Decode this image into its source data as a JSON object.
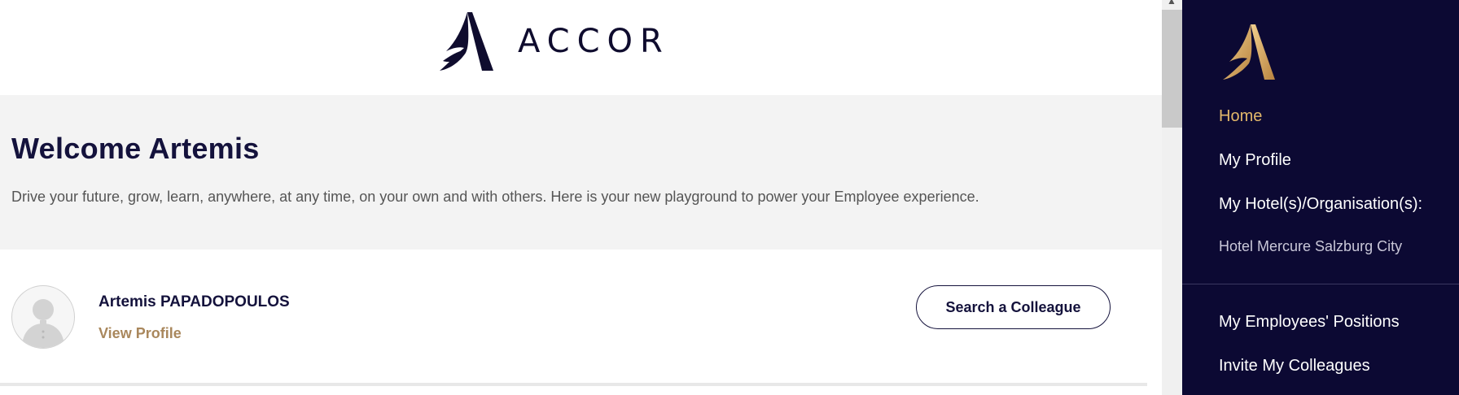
{
  "header": {
    "brand": "ACCOR"
  },
  "hero": {
    "title": "Welcome Artemis",
    "subtitle": "Drive your future, grow, learn, anywhere, at any time, on your own and with others. Here is your new playground to power your Employee experience."
  },
  "profile_card": {
    "name": "Artemis PAPADOPOULOS",
    "view_profile": "View Profile",
    "search_button": "Search a Colleague"
  },
  "sidebar": {
    "items": [
      {
        "label": "Home",
        "active": true
      },
      {
        "label": "My Profile"
      },
      {
        "label": "My Hotel(s)/Organisation(s):"
      },
      {
        "label": "Hotel Mercure Salzburg City"
      },
      {
        "label": "My Employees' Positions"
      },
      {
        "label": "Invite My Colleagues"
      }
    ]
  },
  "colors": {
    "navy": "#0c0933",
    "gold": "#e2b76a",
    "hero_bg": "#f3f3f3",
    "link_gold": "#a9875c"
  }
}
